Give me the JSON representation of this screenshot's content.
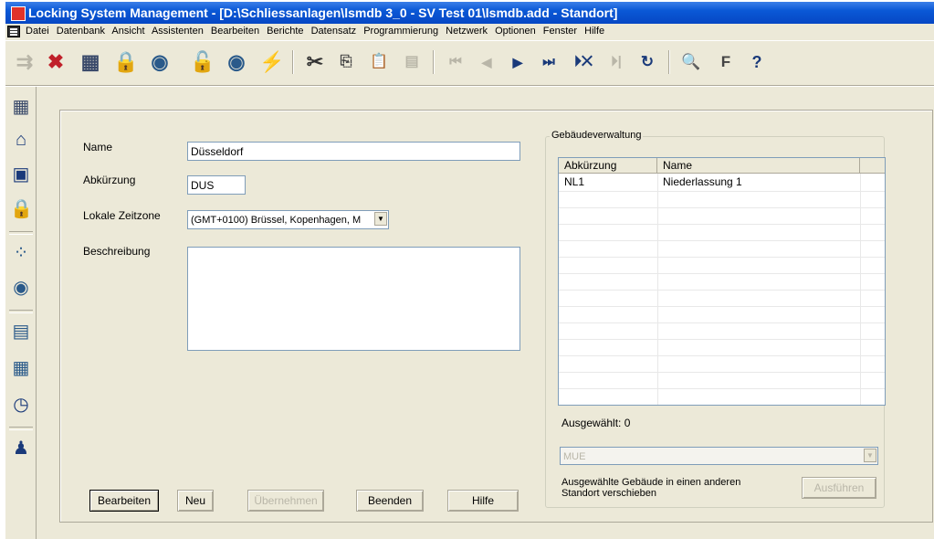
{
  "window": {
    "title": "Locking System Management - [D:\\Schliessanlagen\\lsmdb 3_0 - SV Test 01\\lsmdb.add - Standort]"
  },
  "menu": [
    "Datei",
    "Datenbank",
    "Ansicht",
    "Assistenten",
    "Bearbeiten",
    "Berichte",
    "Datensatz",
    "Programmierung",
    "Netzwerk",
    "Optionen",
    "Fenster",
    "Hilfe"
  ],
  "form": {
    "name_label": "Name",
    "name_value": "Düsseldorf",
    "abbr_label": "Abkürzung",
    "abbr_value": "DUS",
    "timezone_label": "Lokale Zeitzone",
    "timezone_value": "(GMT+0100) Brüssel, Kopenhagen, M",
    "desc_label": "Beschreibung",
    "desc_value": ""
  },
  "buildings": {
    "group_title": "Gebäudeverwaltung",
    "columns": [
      "Abkürzung",
      "Name"
    ],
    "rows": [
      {
        "abbr": "NL1",
        "name": "Niederlassung 1"
      }
    ],
    "selected_label": "Ausgewählt: 0",
    "target_value": "MUE",
    "move_text": "Ausgewählte Gebäude in einen anderen Standort verschieben",
    "execute_label": "Ausführen"
  },
  "buttons": {
    "edit": "Bearbeiten",
    "new": "Neu",
    "apply": "Übernehmen",
    "close": "Beenden",
    "help": "Hilfe"
  },
  "colors": {
    "titlebar": "#0a58d6",
    "dialog_bg": "#ece9d8",
    "disabled_text": "#b9b6a8"
  }
}
